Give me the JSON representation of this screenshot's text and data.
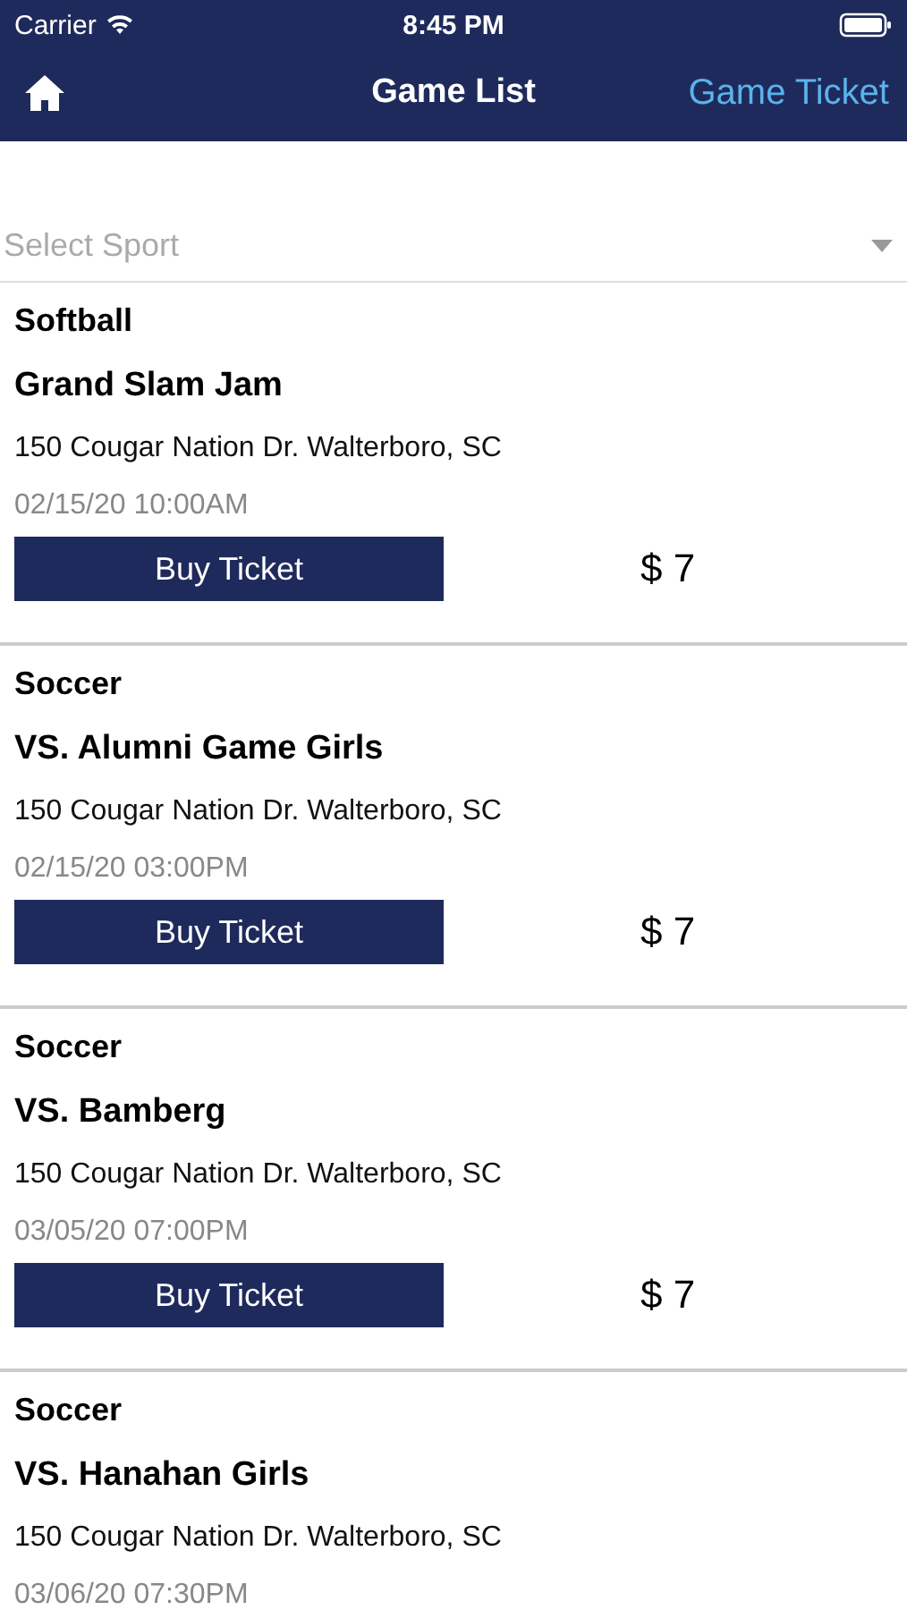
{
  "status_bar": {
    "carrier": "Carrier",
    "time": "8:45 PM"
  },
  "nav": {
    "title": "Game List",
    "action": "Game Ticket"
  },
  "sport_select": {
    "placeholder": "Select Sport"
  },
  "games": [
    {
      "sport": "Softball",
      "name": "Grand Slam Jam",
      "address": "150 Cougar Nation Dr. Walterboro, SC",
      "date": "02/15/20 10:00AM",
      "button": "Buy Ticket",
      "price": "$ 7"
    },
    {
      "sport": "Soccer",
      "name": "VS. Alumni Game Girls",
      "address": "150 Cougar Nation Dr. Walterboro, SC",
      "date": "02/15/20 03:00PM",
      "button": "Buy Ticket",
      "price": "$ 7"
    },
    {
      "sport": "Soccer",
      "name": "VS. Bamberg",
      "address": "150 Cougar Nation Dr. Walterboro, SC",
      "date": "03/05/20 07:00PM",
      "button": "Buy Ticket",
      "price": "$ 7"
    },
    {
      "sport": "Soccer",
      "name": "VS. Hanahan Girls",
      "address": "150 Cougar Nation Dr. Walterboro, SC",
      "date": "03/06/20 07:30PM"
    }
  ]
}
